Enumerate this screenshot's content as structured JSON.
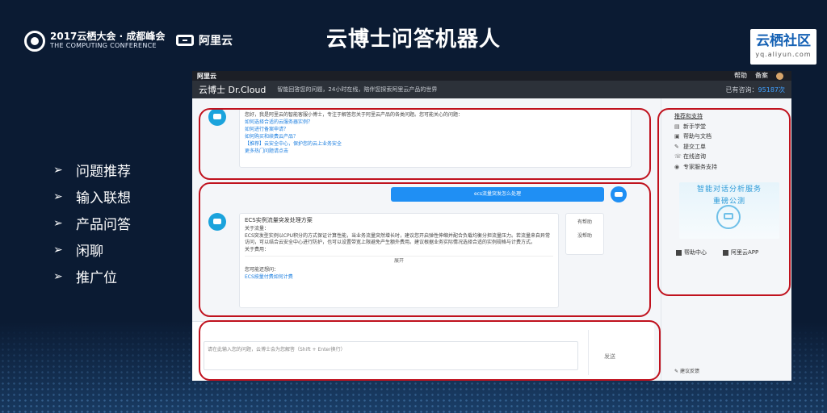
{
  "header": {
    "brand_line1": "2017云栖大会 · 成都峰会",
    "brand_line2": "THE COMPUTING CONFERENCE",
    "aliyun": "阿里云",
    "title": "云博士问答机器人",
    "yunqi_name": "云栖社区",
    "yunqi_url": "yq.aliyun.com"
  },
  "bullets": [
    "问题推荐",
    "输入联想",
    "产品问答",
    "闲聊",
    "推广位"
  ],
  "app": {
    "topbar_logo": "阿里云",
    "topbar_links": [
      "帮助",
      "备案"
    ],
    "name": "云博士 Dr.Cloud",
    "slogan": "智能回答您的问题，24小时在线，陪伴您探索阿里云产品的世界",
    "count_label": "已有咨询：",
    "count_value": "95187次",
    "welcome": {
      "greeting": "您好，我是阿里云的智能客服小博士，专注于解答您关于阿里云产品的各类问题。您可能关心的问题：",
      "lines": [
        "如何选择合适的云服务器实例？",
        "如何进行备案申请？",
        "如何购买和续费云产品？",
        "【推荐】云安全中心，保护您的云上业务安全",
        "更多热门问题请点击"
      ]
    },
    "user_question": "ecs流量突发怎么处理",
    "answer": {
      "title": "ECS实例流量突发处理方案",
      "intro": "关于流量：",
      "body": "ECS突发型实例以CPU积分的方式保证计算性能，当业务流量突然增长时，建议您开启弹性伸缩并配合负载均衡分担流量压力。若流量来自异常访问，可以结合云安全中心进行防护，也可以设置带宽上限避免产生额外费用。建议根据业务实际情况选择合适的实例规格与计费方式。",
      "more_label": "关于费用：",
      "expand": "展开",
      "related_title": "您可能还想问：",
      "related": "ECS按量付费如何计费"
    },
    "feedback": [
      "有帮助",
      "没帮助"
    ],
    "input_placeholder": "请在此输入您的问题，云博士会为您解答（Shift + Enter换行）",
    "send": "发送",
    "sidebar": {
      "title": "推荐和支持",
      "items": [
        "新手学堂",
        "帮助与文档",
        "提交工单",
        "在线咨询",
        "专家服务支持"
      ],
      "ad_title_1": "智能对话分析服务",
      "ad_title_2": "重磅公测",
      "actions": [
        "帮助中心",
        "阿里云APP"
      ],
      "footer": "建议反馈"
    }
  }
}
